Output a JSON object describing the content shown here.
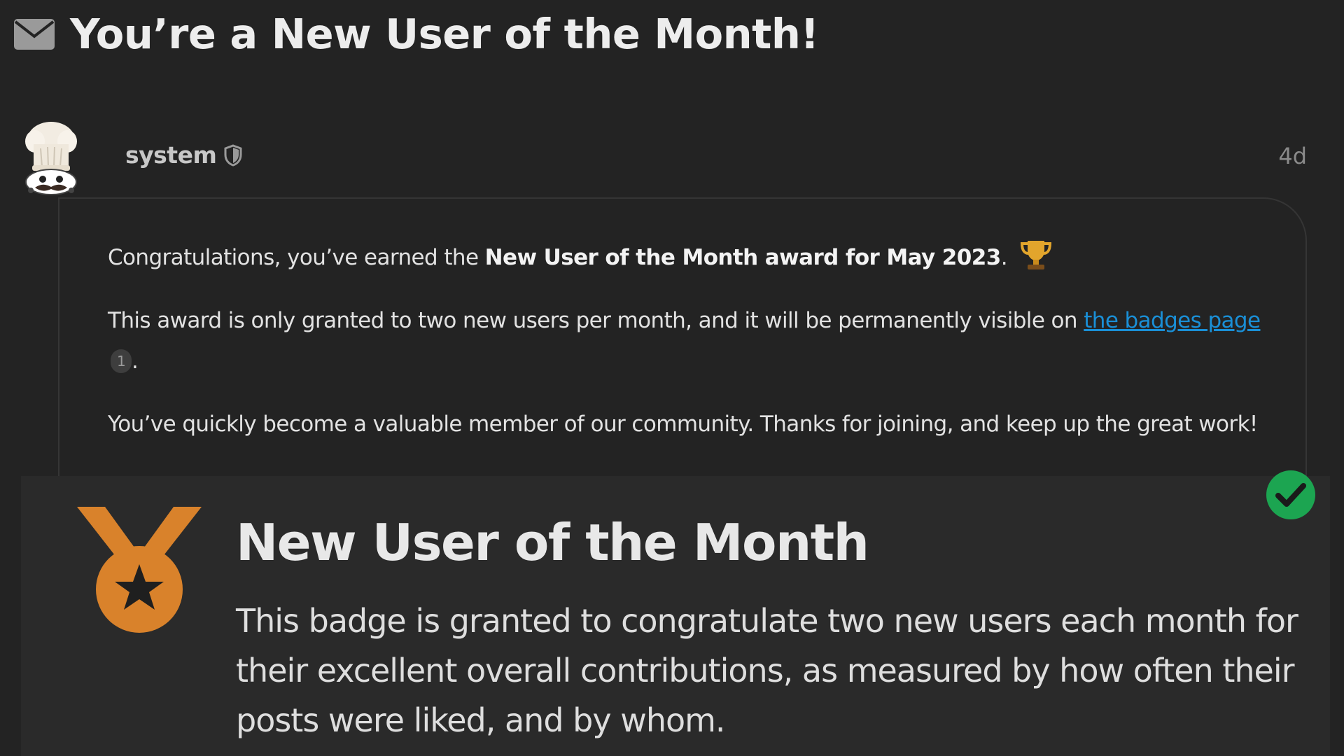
{
  "topic": {
    "icon": "envelope-icon",
    "title": "You’re a New User of the Month!"
  },
  "post": {
    "author": {
      "username": "system",
      "avatar_icon": "chef-hat-avatar",
      "role_icon": "shield-icon"
    },
    "date": "4d",
    "body": {
      "p1_prefix": "Congratulations, you’ve earned the ",
      "p1_bold": "New User of the Month award for May 2023",
      "p1_suffix": ".",
      "p1_emoji": "trophy-icon",
      "p2_prefix": "This award is only granted to two new users per month, and it will be permanently visible on ",
      "p2_link": "the badges page",
      "p2_link_clicks": "1",
      "p2_suffix": ".",
      "p3": "You’ve quickly become a valuable member of our community. Thanks for joining, and keep up the great work!"
    }
  },
  "badge": {
    "icon": "medal-icon",
    "status_icon": "check-icon",
    "name": "New User of the Month",
    "description": "This badge is granted to congratulate two new users each month for their excellent overall contributions, as measured by how often their posts were liked, and by whom."
  },
  "colors": {
    "background": "#232323",
    "link": "#1a8fd6",
    "medal": "#d9822b",
    "check": "#1ca551"
  }
}
